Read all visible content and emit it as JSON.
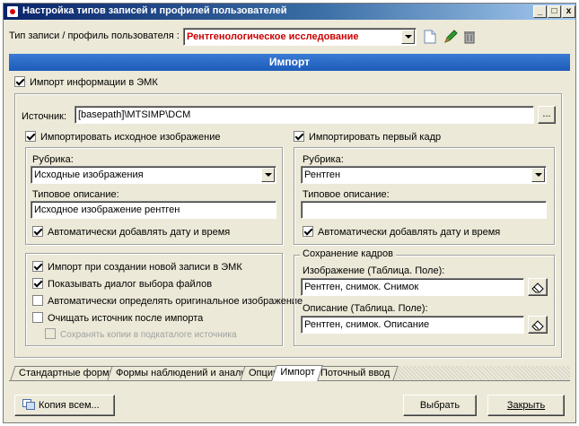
{
  "window": {
    "title": "Настройка типов записей и профилей пользователей",
    "buttons": [
      "_",
      "□",
      "x"
    ]
  },
  "toolbar": {
    "record_type_label": "Тип записи / профиль пользователя :",
    "record_type_value": "Рентгенологическое исследование",
    "record_type_color": "#cc0000"
  },
  "section": {
    "title": "Импорт",
    "header_color": "#1d5bb8"
  },
  "import": {
    "main_checkbox": "Импорт информации в ЭМК",
    "source_label": "Источник:",
    "source_value": "[basepath]\\MTSIMP\\DCM",
    "browse_button": "...",
    "left": {
      "checkbox": "Импортировать исходное изображение",
      "category_label": "Рубрика:",
      "category_value": "Исходные изображения",
      "description_label": "Типовое описание:",
      "description_value": "Исходное изображение рентген",
      "datetime_checkbox": "Автоматически добавлять дату и время"
    },
    "right": {
      "checkbox": "Импортировать первый кадр",
      "category_label": "Рубрика:",
      "category_value": "Рентген",
      "description_label": "Типовое описание:",
      "description_value": "",
      "datetime_checkbox": "Автоматически добавлять дату и время"
    },
    "options": {
      "on_create": "Импорт при создании новой записи в ЭМК",
      "show_dialog": "Показывать диалог выбора файлов",
      "auto_detect": "Автоматически определять оригинальное изображение",
      "clear_source": "Очищать источник после импорта",
      "keep_copies": "Сохранять копии в подкаталоге источника"
    },
    "frames": {
      "title": "Сохранение кадров",
      "image_label": "Изображение (Таблица. Поле):",
      "image_value": "Рентген, снимок. Снимок",
      "desc_label": "Описание (Таблица. Поле):",
      "desc_value": "Рентген, снимок. Описание"
    }
  },
  "tabs": [
    "Стандартные формы",
    "Формы наблюдений и анализов",
    "Опции",
    "Импорт",
    "Поточный ввод"
  ],
  "footer": {
    "copy_all": "Копия всем...",
    "select": "Выбрать",
    "close": "Закрыть"
  }
}
